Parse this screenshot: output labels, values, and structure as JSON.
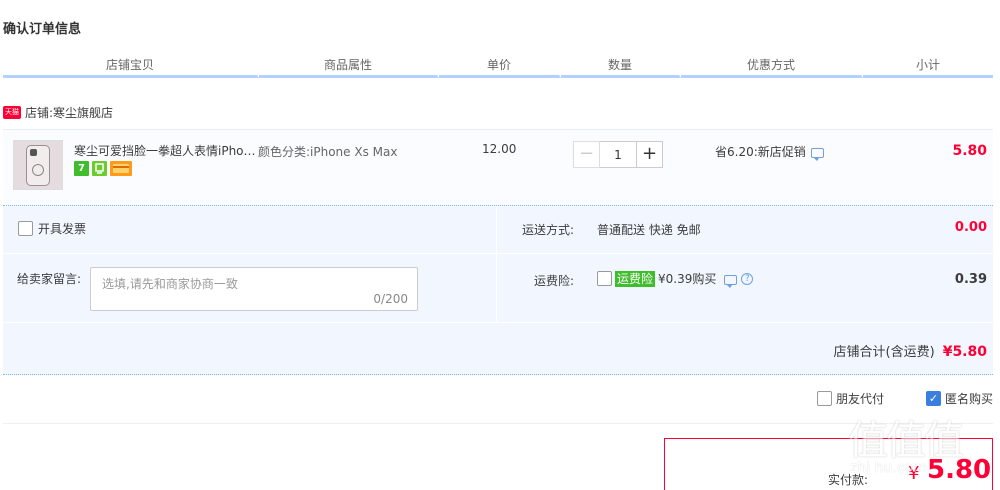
{
  "page": {
    "title": "确认订单信息"
  },
  "table_header": [
    "店铺宝贝",
    "商品属性",
    "单价",
    "数量",
    "优惠方式",
    "小计"
  ],
  "shop": {
    "badge": "天猫",
    "label": "店铺:",
    "name": "寒尘旗舰店"
  },
  "item": {
    "title": "寒尘可爱挡脸一拳超人表情iPhone",
    "attribute": "颜色分类:iPhone Xs Max",
    "price": "12.00",
    "quantity": "1",
    "minus": "−",
    "plus": "+",
    "badges": {
      "seven_day": "7"
    },
    "promotion": "省6.20:新店促销",
    "subtotal": "5.80"
  },
  "invoice": {
    "label": "开具发票"
  },
  "message": {
    "label": "给卖家留言:",
    "placeholder": "选填,请先和商家协商一致",
    "count": "0/200"
  },
  "shipping": {
    "label": "运送方式:",
    "value": "普通配送 快递 免邮",
    "fee": "0.00"
  },
  "insurance": {
    "label": "运费险:",
    "tag": "运费险",
    "price": "¥0.39购买",
    "fee": "0.39",
    "help": "?"
  },
  "shop_total": {
    "label": "店铺合计(含运费)",
    "amount": "¥5.80"
  },
  "options": {
    "friend_pay": "朋友代付",
    "anonymous": "匿名购买",
    "check_mark": "✓"
  },
  "payment": {
    "label": "实付款:",
    "currency": "¥",
    "amount": "5.80"
  },
  "watermark": {
    "glyphs": "值值值",
    "text": "zhi hu.com"
  },
  "colors": {
    "accent": "#ff0036",
    "header_line": "#b2d1ff",
    "panel_bg": "#f2f7ff",
    "check_blue": "#3a7fde"
  }
}
